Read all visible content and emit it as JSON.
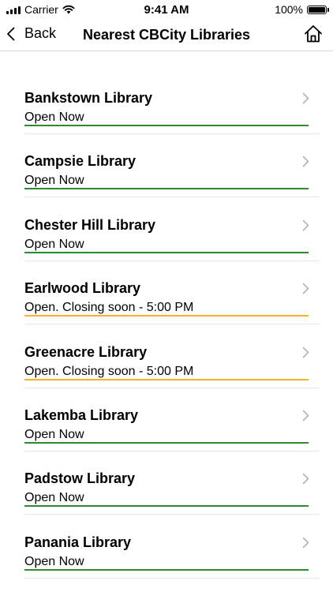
{
  "status_bar": {
    "carrier": "Carrier",
    "time": "9:41 AM",
    "battery": "100%",
    "battery_level": 1.0
  },
  "nav": {
    "back_label": "Back",
    "title": "Nearest CBCity Libraries",
    "home_icon": "home-icon"
  },
  "colors": {
    "open": "#2e8b2e",
    "closing_soon": "#f0b429",
    "chevron": "#b3b3b3",
    "separator": "#e6e6e6"
  },
  "libraries": [
    {
      "name": "Bankstown Library",
      "status": "Open Now",
      "state": "open"
    },
    {
      "name": "Campsie Library",
      "status": "Open Now",
      "state": "open"
    },
    {
      "name": "Chester Hill Library",
      "status": "Open Now",
      "state": "open"
    },
    {
      "name": "Earlwood Library",
      "status": "Open. Closing soon - 5:00 PM",
      "state": "closing_soon"
    },
    {
      "name": "Greenacre Library",
      "status": "Open. Closing soon - 5:00 PM",
      "state": "closing_soon"
    },
    {
      "name": "Lakemba Library",
      "status": "Open Now",
      "state": "open"
    },
    {
      "name": "Padstow Library",
      "status": "Open Now",
      "state": "open"
    },
    {
      "name": "Panania Library",
      "status": "Open Now",
      "state": "open"
    }
  ]
}
